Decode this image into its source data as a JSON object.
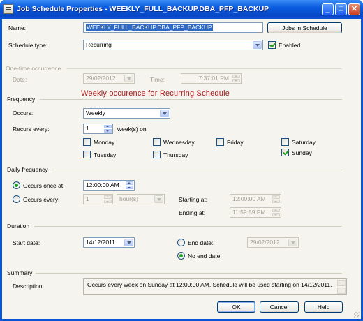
{
  "window": {
    "title": "Job Schedule Properties - WEEKLY_FULL_BACKUP.DBA_PFP_BACKUP",
    "minimize_glyph": "_",
    "maximize_glyph": "□",
    "close_glyph": "✕"
  },
  "name": {
    "label": "Name:",
    "value": "WEEKLY_FULL_BACKUP.DBA_PFP_BACKUP"
  },
  "jobs_button": "Jobs in Schedule",
  "schedule_type": {
    "label": "Schedule type:",
    "value": "Recurring"
  },
  "enabled": {
    "label": "Enabled",
    "checked": true
  },
  "one_time": {
    "header": "One-time occurrence",
    "date_label": "Date:",
    "date_value": "29/02/2012",
    "time_label": "Time:",
    "time_value": "7:37:01 PM"
  },
  "annotation": "Weekly occurence for Recurring Schedule",
  "frequency": {
    "header": "Frequency",
    "occurs_label": "Occurs:",
    "occurs_value": "Weekly",
    "recurs_label": "Recurs every:",
    "recurs_value": "1",
    "recurs_unit": "week(s) on",
    "days": {
      "monday": {
        "label": "Monday",
        "checked": false
      },
      "tuesday": {
        "label": "Tuesday",
        "checked": false
      },
      "wednesday": {
        "label": "Wednesday",
        "checked": false
      },
      "thursday": {
        "label": "Thursday",
        "checked": false
      },
      "friday": {
        "label": "Friday",
        "checked": false
      },
      "saturday": {
        "label": "Saturday",
        "checked": false
      },
      "sunday": {
        "label": "Sunday",
        "checked": true
      }
    }
  },
  "daily": {
    "header": "Daily frequency",
    "once_label": "Occurs once at:",
    "once_value": "12:00:00 AM",
    "once_selected": true,
    "every_label": "Occurs every:",
    "every_value": "1",
    "every_unit": "hour(s)",
    "starting_label": "Starting at:",
    "starting_value": "12:00:00 AM",
    "ending_label": "Ending at:",
    "ending_value": "11:59:59 PM"
  },
  "duration": {
    "header": "Duration",
    "start_label": "Start date:",
    "start_value": "14/12/2011",
    "end_label": "End date:",
    "end_value": "29/02/2012",
    "no_end_label": "No end date:",
    "no_end_selected": true
  },
  "summary": {
    "header": "Summary",
    "desc_label": "Description:",
    "desc_value": "Occurs every week on Sunday at 12:00:00 AM. Schedule will be used starting on 14/12/2011."
  },
  "buttons": {
    "ok": "OK",
    "cancel": "Cancel",
    "help": "Help"
  },
  "colors": {
    "titlebar": "#0a56d6",
    "dialog": "#f5f4ee",
    "annotation": "#a81d1d",
    "check": "#21a121"
  }
}
